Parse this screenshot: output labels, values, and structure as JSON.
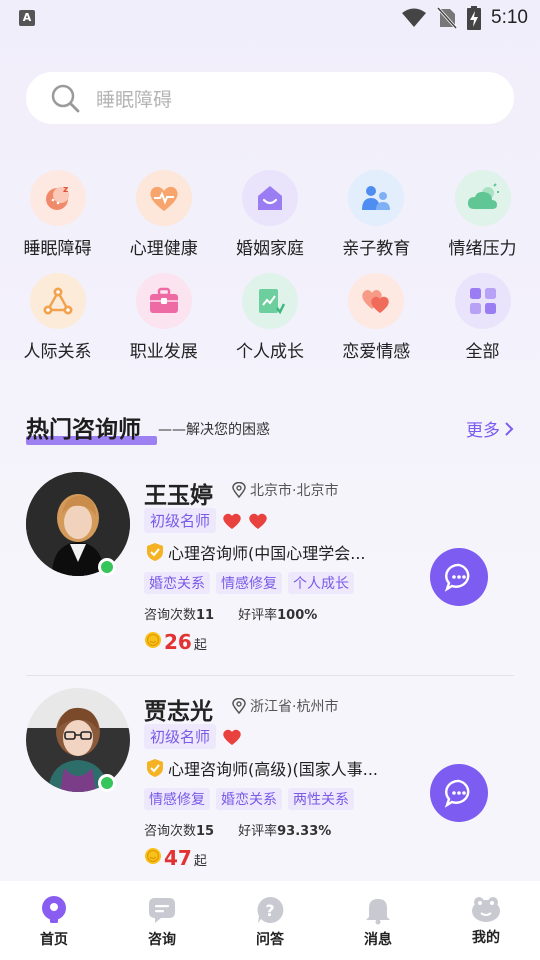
{
  "status_bar": {
    "time": "5:10",
    "left_icon_letter": "A"
  },
  "search": {
    "placeholder": "睡眠障碍"
  },
  "categories": [
    {
      "label": "睡眠障碍",
      "icon": "moon-sleep-icon",
      "bg": "#fde8e2"
    },
    {
      "label": "心理健康",
      "icon": "heart-pulse-icon",
      "bg": "#fde6da"
    },
    {
      "label": "婚姻家庭",
      "icon": "home-smile-icon",
      "bg": "#e9e4fb"
    },
    {
      "label": "亲子教育",
      "icon": "parent-child-icon",
      "bg": "#e2eefb"
    },
    {
      "label": "情绪压力",
      "icon": "cloud-sun-icon",
      "bg": "#e0f3ea"
    },
    {
      "label": "人际关系",
      "icon": "network-icon",
      "bg": "#fdebd9"
    },
    {
      "label": "职业发展",
      "icon": "briefcase-icon",
      "bg": "#fbe3ef"
    },
    {
      "label": "个人成长",
      "icon": "growth-chart-icon",
      "bg": "#e0f3ea"
    },
    {
      "label": "恋爱情感",
      "icon": "hearts-icon",
      "bg": "#fde8e2"
    },
    {
      "label": "全部",
      "icon": "grid-icon",
      "bg": "#e9e4fb"
    }
  ],
  "section": {
    "title": "热门咨询师",
    "subtitle": "——解决您的困惑",
    "more": "更多"
  },
  "consultants": [
    {
      "name": "王玉婷",
      "location": "北京市·北京市",
      "level": "初级名师",
      "hearts": 2,
      "cert": "心理咨询师(中国心理学会...",
      "tags": [
        "婚恋关系",
        "情感修复",
        "个人成长"
      ],
      "consult_label": "咨询次数",
      "consult_count": "11",
      "rating_label": "好评率",
      "rating": "100%",
      "price": "26",
      "price_suffix": "起"
    },
    {
      "name": "贾志光",
      "location": "浙江省·杭州市",
      "level": "初级名师",
      "hearts": 1,
      "cert": "心理咨询师(高级)(国家人事...",
      "tags": [
        "情感修复",
        "婚恋关系",
        "两性关系"
      ],
      "consult_label": "咨询次数",
      "consult_count": "15",
      "rating_label": "好评率",
      "rating": "93.33%",
      "price": "47",
      "price_suffix": "起"
    }
  ],
  "tabbar": [
    {
      "label": "首页",
      "icon": "home-bulb-icon",
      "active": true
    },
    {
      "label": "咨询",
      "icon": "chat-icon",
      "active": false
    },
    {
      "label": "问答",
      "icon": "question-icon",
      "active": false
    },
    {
      "label": "消息",
      "icon": "bell-icon",
      "active": false
    },
    {
      "label": "我的",
      "icon": "profile-face-icon",
      "active": false
    }
  ],
  "colors": {
    "accent": "#7d5cf2",
    "price": "#e33232",
    "tag_bg": "#eee8fd",
    "online": "#35c55a"
  }
}
